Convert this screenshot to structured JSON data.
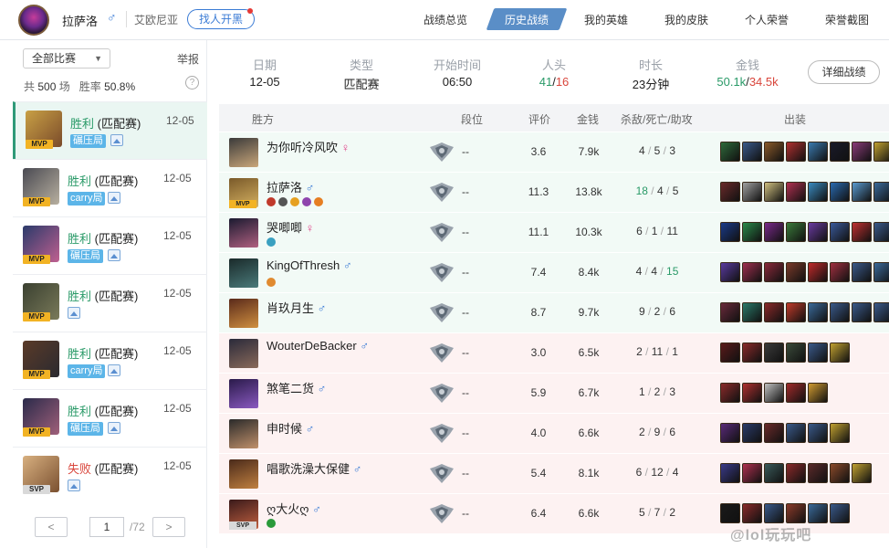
{
  "topbar": {
    "player_name": "拉萨洛",
    "gender_symbol": "♂",
    "server": "艾欧尼亚",
    "find_button": "找人开黑",
    "nav": [
      "战绩总览",
      "历史战绩",
      "我的英雄",
      "我的皮肤",
      "个人荣誉",
      "荣誉截图"
    ],
    "active_nav": "历史战绩"
  },
  "sidebar": {
    "filter_label": "全部比赛",
    "report_label": "举报",
    "total_label": "共",
    "total_count": "500",
    "games_unit": "场",
    "winrate_label": "胜率",
    "winrate": "50.8%",
    "help_label": "?",
    "matches": [
      {
        "result": "胜利",
        "mode": "(匹配赛)",
        "date": "12-05",
        "badge": "MVP",
        "tag": "碾压局",
        "win": true,
        "colors": [
          "#c9a045",
          "#7a4b2a"
        ]
      },
      {
        "result": "胜利",
        "mode": "(匹配赛)",
        "date": "12-05",
        "badge": "MVP",
        "tag": "carry局",
        "win": true,
        "colors": [
          "#4a4a52",
          "#b8b0a0"
        ]
      },
      {
        "result": "胜利",
        "mode": "(匹配赛)",
        "date": "12-05",
        "badge": "MVP",
        "tag": "碾压局",
        "win": true,
        "colors": [
          "#2a3a6a",
          "#c06090"
        ]
      },
      {
        "result": "胜利",
        "mode": "(匹配赛)",
        "date": "12-05",
        "badge": "MVP",
        "tag": "",
        "win": true,
        "colors": [
          "#3a4030",
          "#7a7a5a"
        ]
      },
      {
        "result": "胜利",
        "mode": "(匹配赛)",
        "date": "12-05",
        "badge": "MVP",
        "tag": "carry局",
        "win": true,
        "colors": [
          "#5a3a28",
          "#2a2a30"
        ]
      },
      {
        "result": "胜利",
        "mode": "(匹配赛)",
        "date": "12-05",
        "badge": "MVP",
        "tag": "碾压局",
        "win": true,
        "colors": [
          "#2a2a4a",
          "#a0607a"
        ]
      },
      {
        "result": "失败",
        "mode": "(匹配赛)",
        "date": "12-05",
        "badge": "SVP",
        "tag": "",
        "win": false,
        "colors": [
          "#d8b080",
          "#7a5030"
        ]
      }
    ],
    "pager": {
      "prev": "<",
      "next": ">",
      "page": "1",
      "total": "/72"
    }
  },
  "summary": {
    "date_label": "日期",
    "date": "12-05",
    "type_label": "类型",
    "type": "匹配赛",
    "start_label": "开始时间",
    "start": "06:50",
    "kills_label": "人头",
    "kills_a": "41",
    "kills_sep": "/",
    "kills_b": "16",
    "duration_label": "时长",
    "duration": "23分钟",
    "gold_label": "金钱",
    "gold_a": "50.1k",
    "gold_sep": "/",
    "gold_b": "34.5k",
    "detail_button": "详细战绩"
  },
  "table": {
    "headers": {
      "side": "胜方",
      "rank": "段位",
      "score": "评价",
      "gold": "金钱",
      "kda": "杀敌/死亡/助攻",
      "items": "出装"
    },
    "rows": [
      {
        "name": "为你听冷风吹",
        "gender": "♀",
        "rank": "--",
        "score": "3.6",
        "gold": "7.9k",
        "k": "4",
        "d": "5",
        "a": "3",
        "badge": "",
        "win": true,
        "highlight": "",
        "face": [
          "#3a3a3a",
          "#caa77a"
        ],
        "tags": [],
        "items": [
          "#2f6a3a",
          "#3a5a8a",
          "#8a5a2a",
          "#b03030",
          "#3a7ab0",
          "#1a1a2a",
          "#8a3a7a",
          "#c0a030"
        ]
      },
      {
        "name": "拉萨洛",
        "gender": "♂",
        "rank": "--",
        "score": "11.3",
        "gold": "13.8k",
        "k": "18",
        "d": "4",
        "a": "5",
        "badge": "MVP",
        "win": true,
        "highlight": "green",
        "face": [
          "#7a5a2a",
          "#d4b060"
        ],
        "tags": [
          "#c0392b",
          "#555",
          "#e6a020",
          "#8e44ad",
          "#e67e22"
        ],
        "items": [
          "#6a2a2a",
          "#a0a0a0",
          "#d0c080",
          "#b03050",
          "#3a8ac0",
          "#2a6ab0",
          "#5a9ad0",
          "#3a6a9a"
        ]
      },
      {
        "name": "哭唧唧",
        "gender": "♀",
        "rank": "--",
        "score": "11.1",
        "gold": "10.3k",
        "k": "6",
        "d": "1",
        "a": "11",
        "badge": "",
        "win": true,
        "highlight": "",
        "face": [
          "#1a1a30",
          "#b06080"
        ],
        "tags": [
          "#3aa0c0"
        ],
        "items": [
          "#1a3a8a",
          "#2a8a4a",
          "#7a2a8a",
          "#3a7a3a",
          "#6a3aa0",
          "#3a5a9a",
          "#c03030",
          "#3a5a8a"
        ]
      },
      {
        "name": "KingOfThresh",
        "gender": "♂",
        "rank": "--",
        "score": "7.4",
        "gold": "8.4k",
        "k": "4",
        "d": "4",
        "a": "15",
        "badge": "",
        "win": true,
        "highlight": "",
        "face": [
          "#1a2a2a",
          "#4a7a7a"
        ],
        "tags": [
          "#e08a30"
        ],
        "items": [
          "#5a3aa0",
          "#a03050",
          "#8a2a3a",
          "#7a3a2a",
          "#c02a2a",
          "#a03040",
          "#3a5a8a",
          "#3a6a9a"
        ]
      },
      {
        "name": "肖玖月生",
        "gender": "♂",
        "rank": "--",
        "score": "8.7",
        "gold": "9.7k",
        "k": "9",
        "d": "2",
        "a": "6",
        "badge": "",
        "win": true,
        "highlight": "",
        "face": [
          "#5a2a1a",
          "#d09040"
        ],
        "tags": [],
        "items": [
          "#6a2a3a",
          "#2a7a6a",
          "#8a2a2a",
          "#c03a2a",
          "#3a6a9a",
          "#3a5a8a",
          "#3a5a8a",
          "#3a5a8a"
        ]
      },
      {
        "name": "WouterDeBacker",
        "gender": "♂",
        "rank": "--",
        "score": "3.0",
        "gold": "6.5k",
        "k": "2",
        "d": "11",
        "a": "1",
        "badge": "",
        "win": false,
        "highlight": "",
        "face": [
          "#2a2a3a",
          "#8a6a5a"
        ],
        "tags": [],
        "items": [
          "#5a1a1a",
          "#8a2a2a",
          "#3a3a3a",
          "#3a4a3a",
          "#3a5a8a",
          "#c0a030",
          "#ffffff",
          "#ffffff"
        ]
      },
      {
        "name": "煞笔二货",
        "gender": "♂",
        "rank": "--",
        "score": "5.9",
        "gold": "6.7k",
        "k": "1",
        "d": "2",
        "a": "3",
        "badge": "",
        "win": false,
        "highlight": "",
        "face": [
          "#2a1a4a",
          "#8a5ac0"
        ],
        "tags": [],
        "items": [
          "#8a2a2a",
          "#b03030",
          "#c0c0c0",
          "#a02a2a",
          "#d09a30",
          "#ffffff",
          "#ffffff",
          "#ffffff"
        ]
      },
      {
        "name": "申时候",
        "gender": "♂",
        "rank": "--",
        "score": "4.0",
        "gold": "6.6k",
        "k": "2",
        "d": "9",
        "a": "6",
        "badge": "",
        "win": false,
        "highlight": "",
        "face": [
          "#2a2a2a",
          "#c0906a"
        ],
        "tags": [],
        "items": [
          "#5a2a7a",
          "#2a3a6a",
          "#6a2a2a",
          "#3a5a8a",
          "#3a5a8a",
          "#c0a030",
          "#ffffff",
          "#ffffff"
        ]
      },
      {
        "name": "唱歌洗澡大保健",
        "gender": "♂",
        "rank": "--",
        "score": "5.4",
        "gold": "8.1k",
        "k": "6",
        "d": "12",
        "a": "4",
        "badge": "",
        "win": false,
        "highlight": "",
        "face": [
          "#4a2a1a",
          "#c08040"
        ],
        "tags": [],
        "items": [
          "#3a3a8a",
          "#b03050",
          "#3a5a5a",
          "#8a2a2a",
          "#5a2a2a",
          "#8a4a2a",
          "#c0a030",
          "#ffffff"
        ]
      },
      {
        "name": "ღ大火ღ",
        "gender": "♂",
        "rank": "--",
        "score": "6.4",
        "gold": "6.6k",
        "k": "5",
        "d": "7",
        "a": "2",
        "badge": "SVP",
        "win": false,
        "highlight": "",
        "face": [
          "#3a1a1a",
          "#c06040"
        ],
        "tags": [
          "#2a9a3a"
        ],
        "items": [
          "#1a1a1a",
          "#8a2a2a",
          "#3a5a8a",
          "#8a3a2a",
          "#3a6a9a",
          "#3a5a8a",
          "#ffffff",
          "#ffffff"
        ]
      }
    ]
  },
  "watermark": "@lol玩玩吧"
}
